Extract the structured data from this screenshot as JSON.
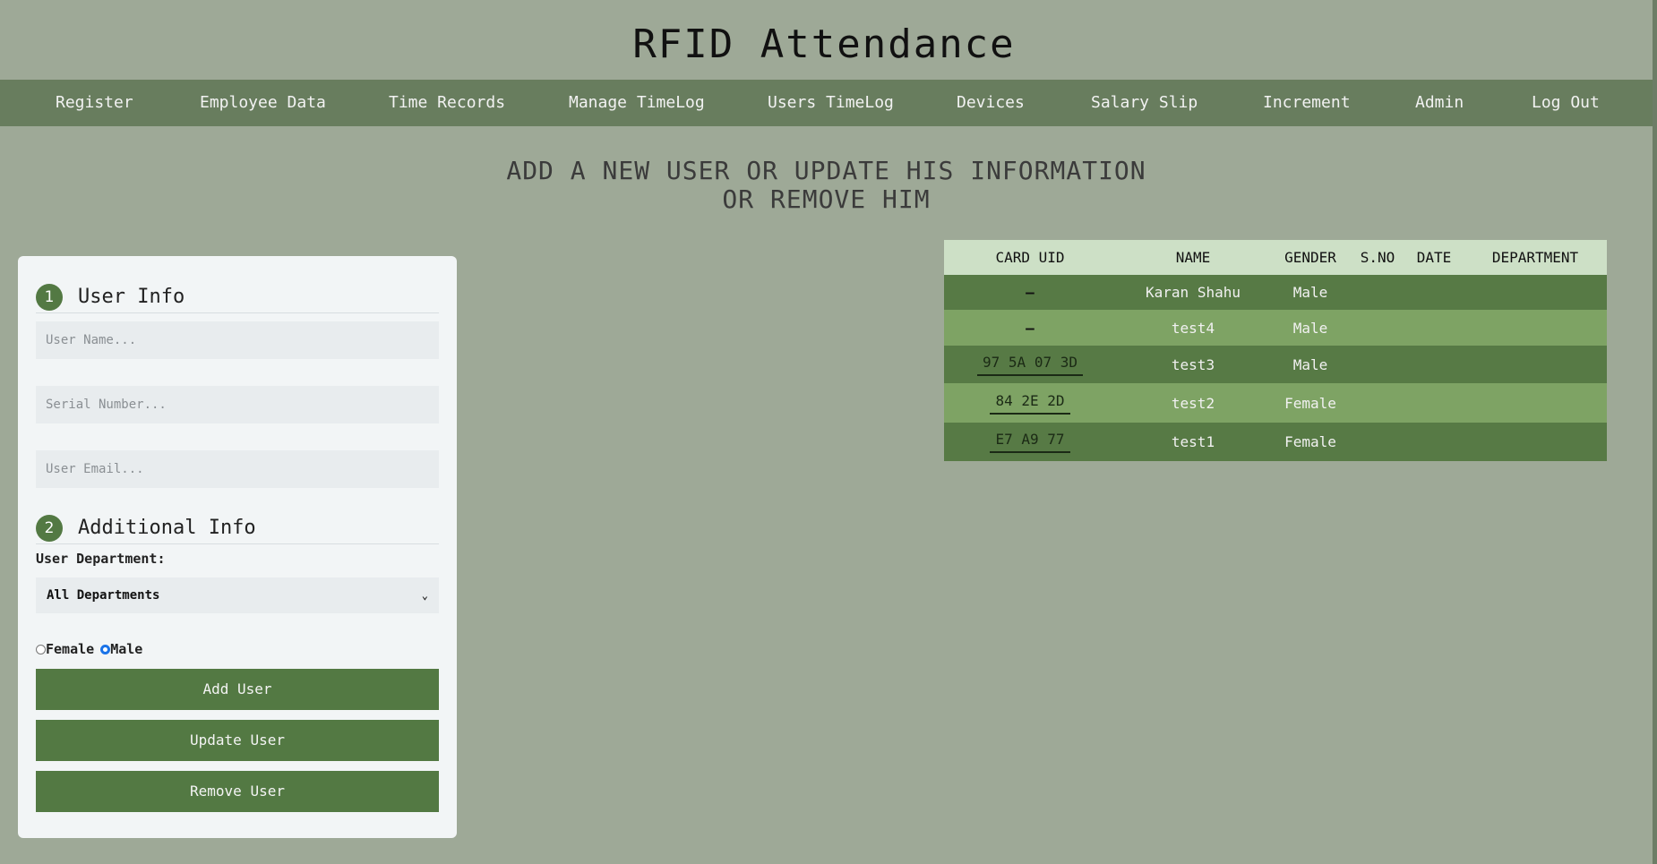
{
  "app": {
    "title": "RFID Attendance"
  },
  "nav": {
    "items": [
      "Register",
      "Employee Data",
      "Time Records",
      "Manage TimeLog",
      "Users TimeLog",
      "Devices",
      "Salary Slip",
      "Increment",
      "Admin",
      "Log Out"
    ]
  },
  "main": {
    "heading_line1": "ADD A NEW USER OR UPDATE HIS INFORMATION",
    "heading_line2": "OR REMOVE HIM"
  },
  "form": {
    "section1": {
      "step": "1",
      "title": "User Info"
    },
    "section2": {
      "step": "2",
      "title": "Additional Info"
    },
    "user_name_placeholder": "User Name...",
    "serial_number_placeholder": "Serial Number...",
    "user_email_placeholder": "User Email...",
    "department_label": "User Department:",
    "department_selected": "All Departments",
    "gender_female_label": "Female",
    "gender_male_label": "Male",
    "gender_selected": "Male",
    "add_button": "Add User",
    "update_button": "Update User",
    "remove_button": "Remove User"
  },
  "table": {
    "headers": [
      "CARD UID",
      "NAME",
      "GENDER",
      "S.NO",
      "DATE",
      "DEPARTMENT"
    ],
    "rows": [
      {
        "uid": "—",
        "name": "Karan Shahu",
        "gender": "Male",
        "sno": "",
        "date": "",
        "department": ""
      },
      {
        "uid": "—",
        "name": "test4",
        "gender": "Male",
        "sno": "",
        "date": "",
        "department": ""
      },
      {
        "uid": "97 5A 07 3D",
        "name": "test3",
        "gender": "Male",
        "sno": "",
        "date": "",
        "department": ""
      },
      {
        "uid": "84 2E 2D",
        "name": "test2",
        "gender": "Female",
        "sno": "",
        "date": "",
        "department": ""
      },
      {
        "uid": "E7 A9 77",
        "name": "test1",
        "gender": "Female",
        "sno": "",
        "date": "",
        "department": ""
      }
    ]
  },
  "colors": {
    "background": "#9ea997",
    "navbar": "#687d5e",
    "accent": "#537943",
    "row_dark": "#577a45",
    "row_light": "#7ea364",
    "table_header": "#cde0c6"
  }
}
